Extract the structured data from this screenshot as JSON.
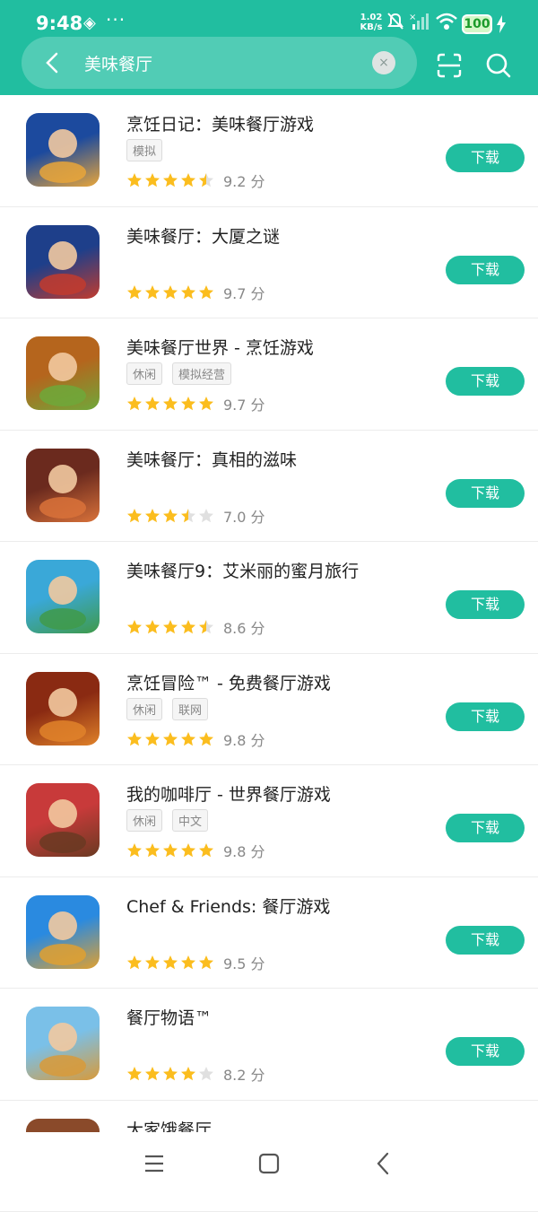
{
  "status_bar": {
    "time": "9:48",
    "dots": "···",
    "net_speed_value": "1.02",
    "net_speed_unit": "KB/s",
    "battery": "100"
  },
  "search": {
    "query": "美味餐厅",
    "clear_glyph": "×"
  },
  "apps": [
    {
      "title": "烹饪日记：美味餐厅游戏",
      "tags": [
        "模拟"
      ],
      "stars": 4.5,
      "score": "9.2 分",
      "button": "下载",
      "icon_colors": [
        "#1c4a9e",
        "#e9a63a"
      ]
    },
    {
      "title": "美味餐厅：大厦之谜",
      "tags": [],
      "stars": 5,
      "score": "9.7 分",
      "button": "下载",
      "icon_colors": [
        "#1e3f8a",
        "#c23b2e"
      ]
    },
    {
      "title": "美味餐厅世界 - 烹饪游戏",
      "tags": [
        "休闲",
        "模拟经营"
      ],
      "stars": 5,
      "score": "9.7 分",
      "button": "下载",
      "icon_colors": [
        "#b5651d",
        "#6fa83a"
      ]
    },
    {
      "title": "美味餐厅：真相的滋味",
      "tags": [],
      "stars": 3.5,
      "score": "7.0 分",
      "button": "下载",
      "icon_colors": [
        "#6b2a1e",
        "#d9723a"
      ]
    },
    {
      "title": "美味餐厅9：艾米丽的蜜月旅行",
      "tags": [],
      "stars": 4.5,
      "score": "8.6 分",
      "button": "下载",
      "icon_colors": [
        "#3aa8d8",
        "#3f9a4a"
      ]
    },
    {
      "title": "烹饪冒险™ - 免费餐厅游戏",
      "tags": [
        "休闲",
        "联网"
      ],
      "stars": 5,
      "score": "9.8 分",
      "button": "下载",
      "icon_colors": [
        "#8a2a12",
        "#e0822a"
      ]
    },
    {
      "title": "我的咖啡厅 - 世界餐厅游戏",
      "tags": [
        "休闲",
        "中文"
      ],
      "stars": 5,
      "score": "9.8 分",
      "button": "下载",
      "icon_colors": [
        "#c83a3a",
        "#6a3a22"
      ]
    },
    {
      "title": "Chef & Friends: 餐厅游戏",
      "tags": [],
      "stars": 5,
      "score": "9.5 分",
      "button": "下载",
      "icon_colors": [
        "#2a8ae0",
        "#e0a030"
      ]
    },
    {
      "title": "餐厅物语™",
      "tags": [],
      "stars": 4,
      "score": "8.2 分",
      "button": "下载",
      "icon_colors": [
        "#7ac0e8",
        "#d89a3a"
      ]
    },
    {
      "title": "大家饿餐厅",
      "tags": [],
      "stars": 0,
      "score": "",
      "button": "",
      "icon_colors": [
        "#8a4a2a",
        "#f0f0f0"
      ]
    }
  ],
  "colors": {
    "accent": "#21bea0",
    "star_on": "#fbbd1e",
    "star_off": "#e0e0e0"
  }
}
